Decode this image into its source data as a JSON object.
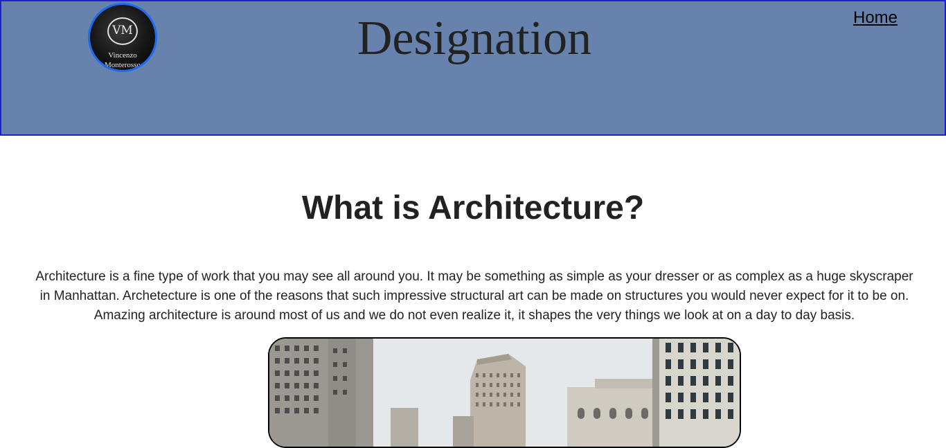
{
  "header": {
    "logo": {
      "monogram": "VM",
      "name_line1": "Vincenzo",
      "name_line2": "Monterosso"
    },
    "title": "Designation",
    "nav": {
      "home_label": "Home"
    },
    "colors": {
      "background": "#6783ad",
      "border": "#1f1fcf",
      "logo_ring": "#1e6bf0"
    }
  },
  "main": {
    "heading": "What is Architecture?",
    "intro_lines": [
      "Architecture is a fine type of work that you may see all around you. It may be something as simple as your dresser or as complex as a huge skyscraper",
      "in Manhattan. Archetecture is one of the reasons that such impressive structural art can be made on structures you would never expect for it to be on.",
      "Amazing architecture is around most of us and we do not even realize it, it shapes the very things we look at on a day to day basis."
    ]
  }
}
